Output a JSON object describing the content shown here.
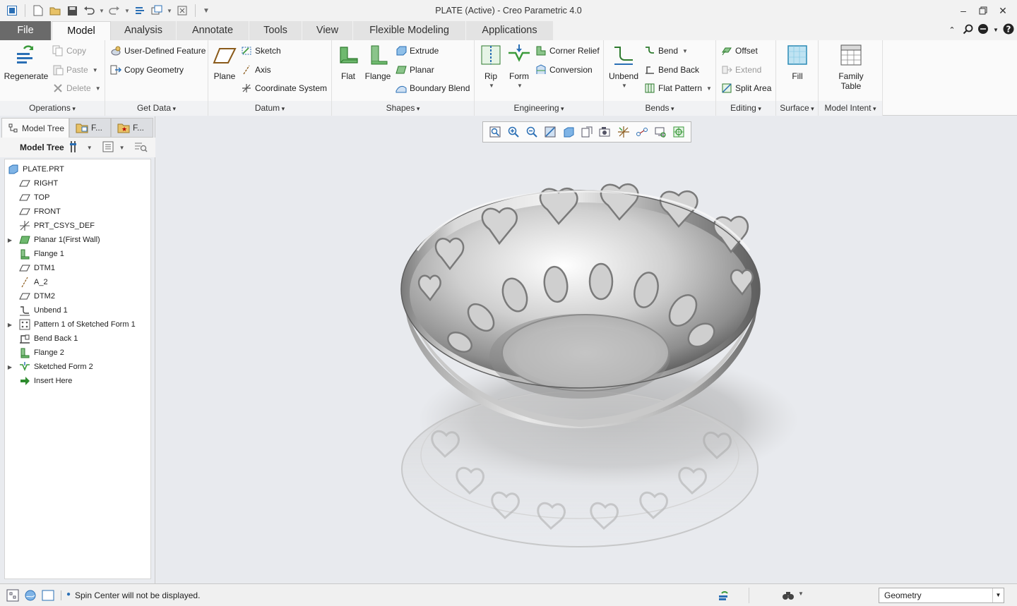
{
  "window": {
    "title": "PLATE (Active) - Creo Parametric 4.0"
  },
  "tabs": [
    {
      "label": "File"
    },
    {
      "label": "Model"
    },
    {
      "label": "Analysis"
    },
    {
      "label": "Annotate"
    },
    {
      "label": "Tools"
    },
    {
      "label": "View"
    },
    {
      "label": "Flexible Modeling"
    },
    {
      "label": "Applications"
    }
  ],
  "ribbon": {
    "operations": {
      "label": "Operations",
      "regenerate": "Regenerate",
      "copy": "Copy",
      "paste": "Paste",
      "delete": "Delete"
    },
    "get_data": {
      "label": "Get Data",
      "udf": "User-Defined Feature",
      "copy_geometry": "Copy Geometry"
    },
    "datum": {
      "label": "Datum",
      "plane": "Plane",
      "sketch": "Sketch",
      "axis": "Axis",
      "coordinate_system": "Coordinate System"
    },
    "shapes": {
      "label": "Shapes",
      "flat": "Flat",
      "flange": "Flange",
      "extrude": "Extrude",
      "planar": "Planar",
      "boundary_blend": "Boundary Blend"
    },
    "engineering": {
      "label": "Engineering",
      "rip": "Rip",
      "form": "Form",
      "corner_relief": "Corner Relief",
      "conversion": "Conversion"
    },
    "bends": {
      "label": "Bends",
      "unbend": "Unbend",
      "bend": "Bend",
      "bend_back": "Bend Back",
      "flat_pattern": "Flat Pattern"
    },
    "editing": {
      "label": "Editing",
      "offset": "Offset",
      "extend": "Extend",
      "split_area": "Split Area"
    },
    "surface": {
      "label": "Surface",
      "fill": "Fill"
    },
    "model_intent": {
      "label": "Model Intent",
      "family_table_1": "Family",
      "family_table_2": "Table"
    }
  },
  "panel": {
    "tabs": [
      "Model Tree",
      "F...",
      "F..."
    ],
    "toolbar_title": "Model Tree"
  },
  "tree": [
    {
      "label": "PLATE.PRT",
      "icon": "part-icon",
      "expandable": false
    },
    {
      "label": "RIGHT",
      "icon": "datum-plane-icon",
      "expandable": false
    },
    {
      "label": "TOP",
      "icon": "datum-plane-icon",
      "expandable": false
    },
    {
      "label": "FRONT",
      "icon": "datum-plane-icon",
      "expandable": false
    },
    {
      "label": "PRT_CSYS_DEF",
      "icon": "csys-icon",
      "expandable": false
    },
    {
      "label": "Planar 1(First Wall)",
      "icon": "planar-wall-icon",
      "expandable": true
    },
    {
      "label": "Flange 1",
      "icon": "flange-icon",
      "expandable": false
    },
    {
      "label": "DTM1",
      "icon": "datum-plane-icon",
      "expandable": false
    },
    {
      "label": "A_2",
      "icon": "axis-icon",
      "expandable": false
    },
    {
      "label": "DTM2",
      "icon": "datum-plane-icon",
      "expandable": false
    },
    {
      "label": "Unbend 1",
      "icon": "unbend-icon",
      "expandable": false
    },
    {
      "label": "Pattern 1 of Sketched Form 1",
      "icon": "pattern-icon",
      "expandable": true
    },
    {
      "label": "Bend Back 1",
      "icon": "bend-back-icon",
      "expandable": false
    },
    {
      "label": "Flange 2",
      "icon": "flange-icon",
      "expandable": false
    },
    {
      "label": "Sketched Form 2",
      "icon": "sketched-form-icon",
      "expandable": true
    },
    {
      "label": "Insert Here",
      "icon": "insert-here-icon",
      "expandable": false
    }
  ],
  "status": {
    "message": "Spin Center will not be displayed.",
    "filter_value": "Geometry"
  },
  "colors": {
    "file_tab": "#6a6a6a",
    "accent_green": "#3a9a3a",
    "accent_blue": "#2a6fb5",
    "viewport_bg": "#e8eaee"
  }
}
